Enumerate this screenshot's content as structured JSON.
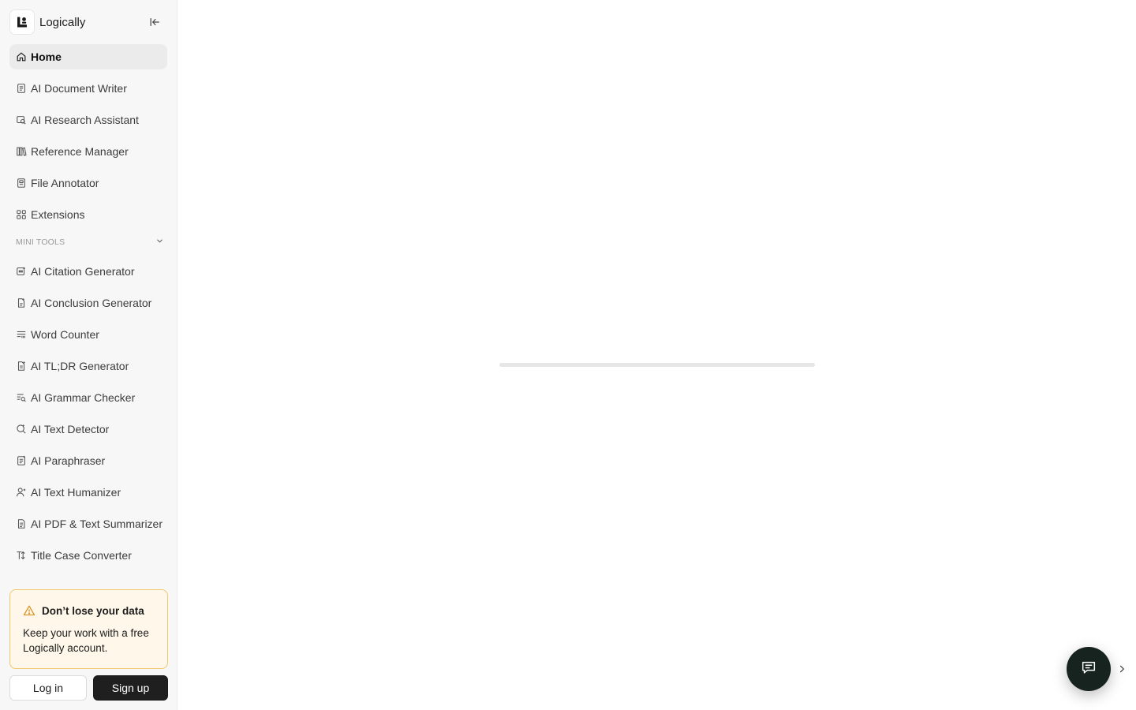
{
  "brand": {
    "name": "Logically"
  },
  "nav_main": [
    {
      "label": "Home",
      "icon": "home-icon",
      "active": true
    },
    {
      "label": "AI Document Writer",
      "icon": "document-icon"
    },
    {
      "label": "AI Research Assistant",
      "icon": "research-icon"
    },
    {
      "label": "Reference Manager",
      "icon": "library-icon"
    },
    {
      "label": "File Annotator",
      "icon": "file-icon"
    },
    {
      "label": "Extensions",
      "icon": "grid-icon"
    }
  ],
  "mini_tools": {
    "label": "MINI TOOLS",
    "items": [
      {
        "label": "AI Citation Generator",
        "icon": "citation-icon"
      },
      {
        "label": "AI Conclusion Generator",
        "icon": "conclusion-icon"
      },
      {
        "label": "Word Counter",
        "icon": "word-count-icon"
      },
      {
        "label": "AI TL;DR Generator",
        "icon": "tldr-icon"
      },
      {
        "label": "AI Grammar Checker",
        "icon": "grammar-icon"
      },
      {
        "label": "AI Text Detector",
        "icon": "detector-icon"
      },
      {
        "label": "AI Paraphraser",
        "icon": "paraphrase-icon"
      },
      {
        "label": "AI Text Humanizer",
        "icon": "humanizer-icon"
      },
      {
        "label": "AI PDF & Text Summarizer",
        "icon": "summarizer-icon"
      },
      {
        "label": "Title Case Converter",
        "icon": "title-case-icon"
      }
    ]
  },
  "notice": {
    "title": "Don’t lose your data",
    "body": "Keep your work with a free Logically account."
  },
  "auth": {
    "login_label": "Log in",
    "signup_label": "Sign up"
  },
  "colors": {
    "sidebar_bg": "#f7f7f7",
    "notice_bg": "#fff8ea",
    "notice_border": "#f2c66c",
    "fab_bg": "#17231f",
    "signup_bg": "#1f1f1f"
  }
}
